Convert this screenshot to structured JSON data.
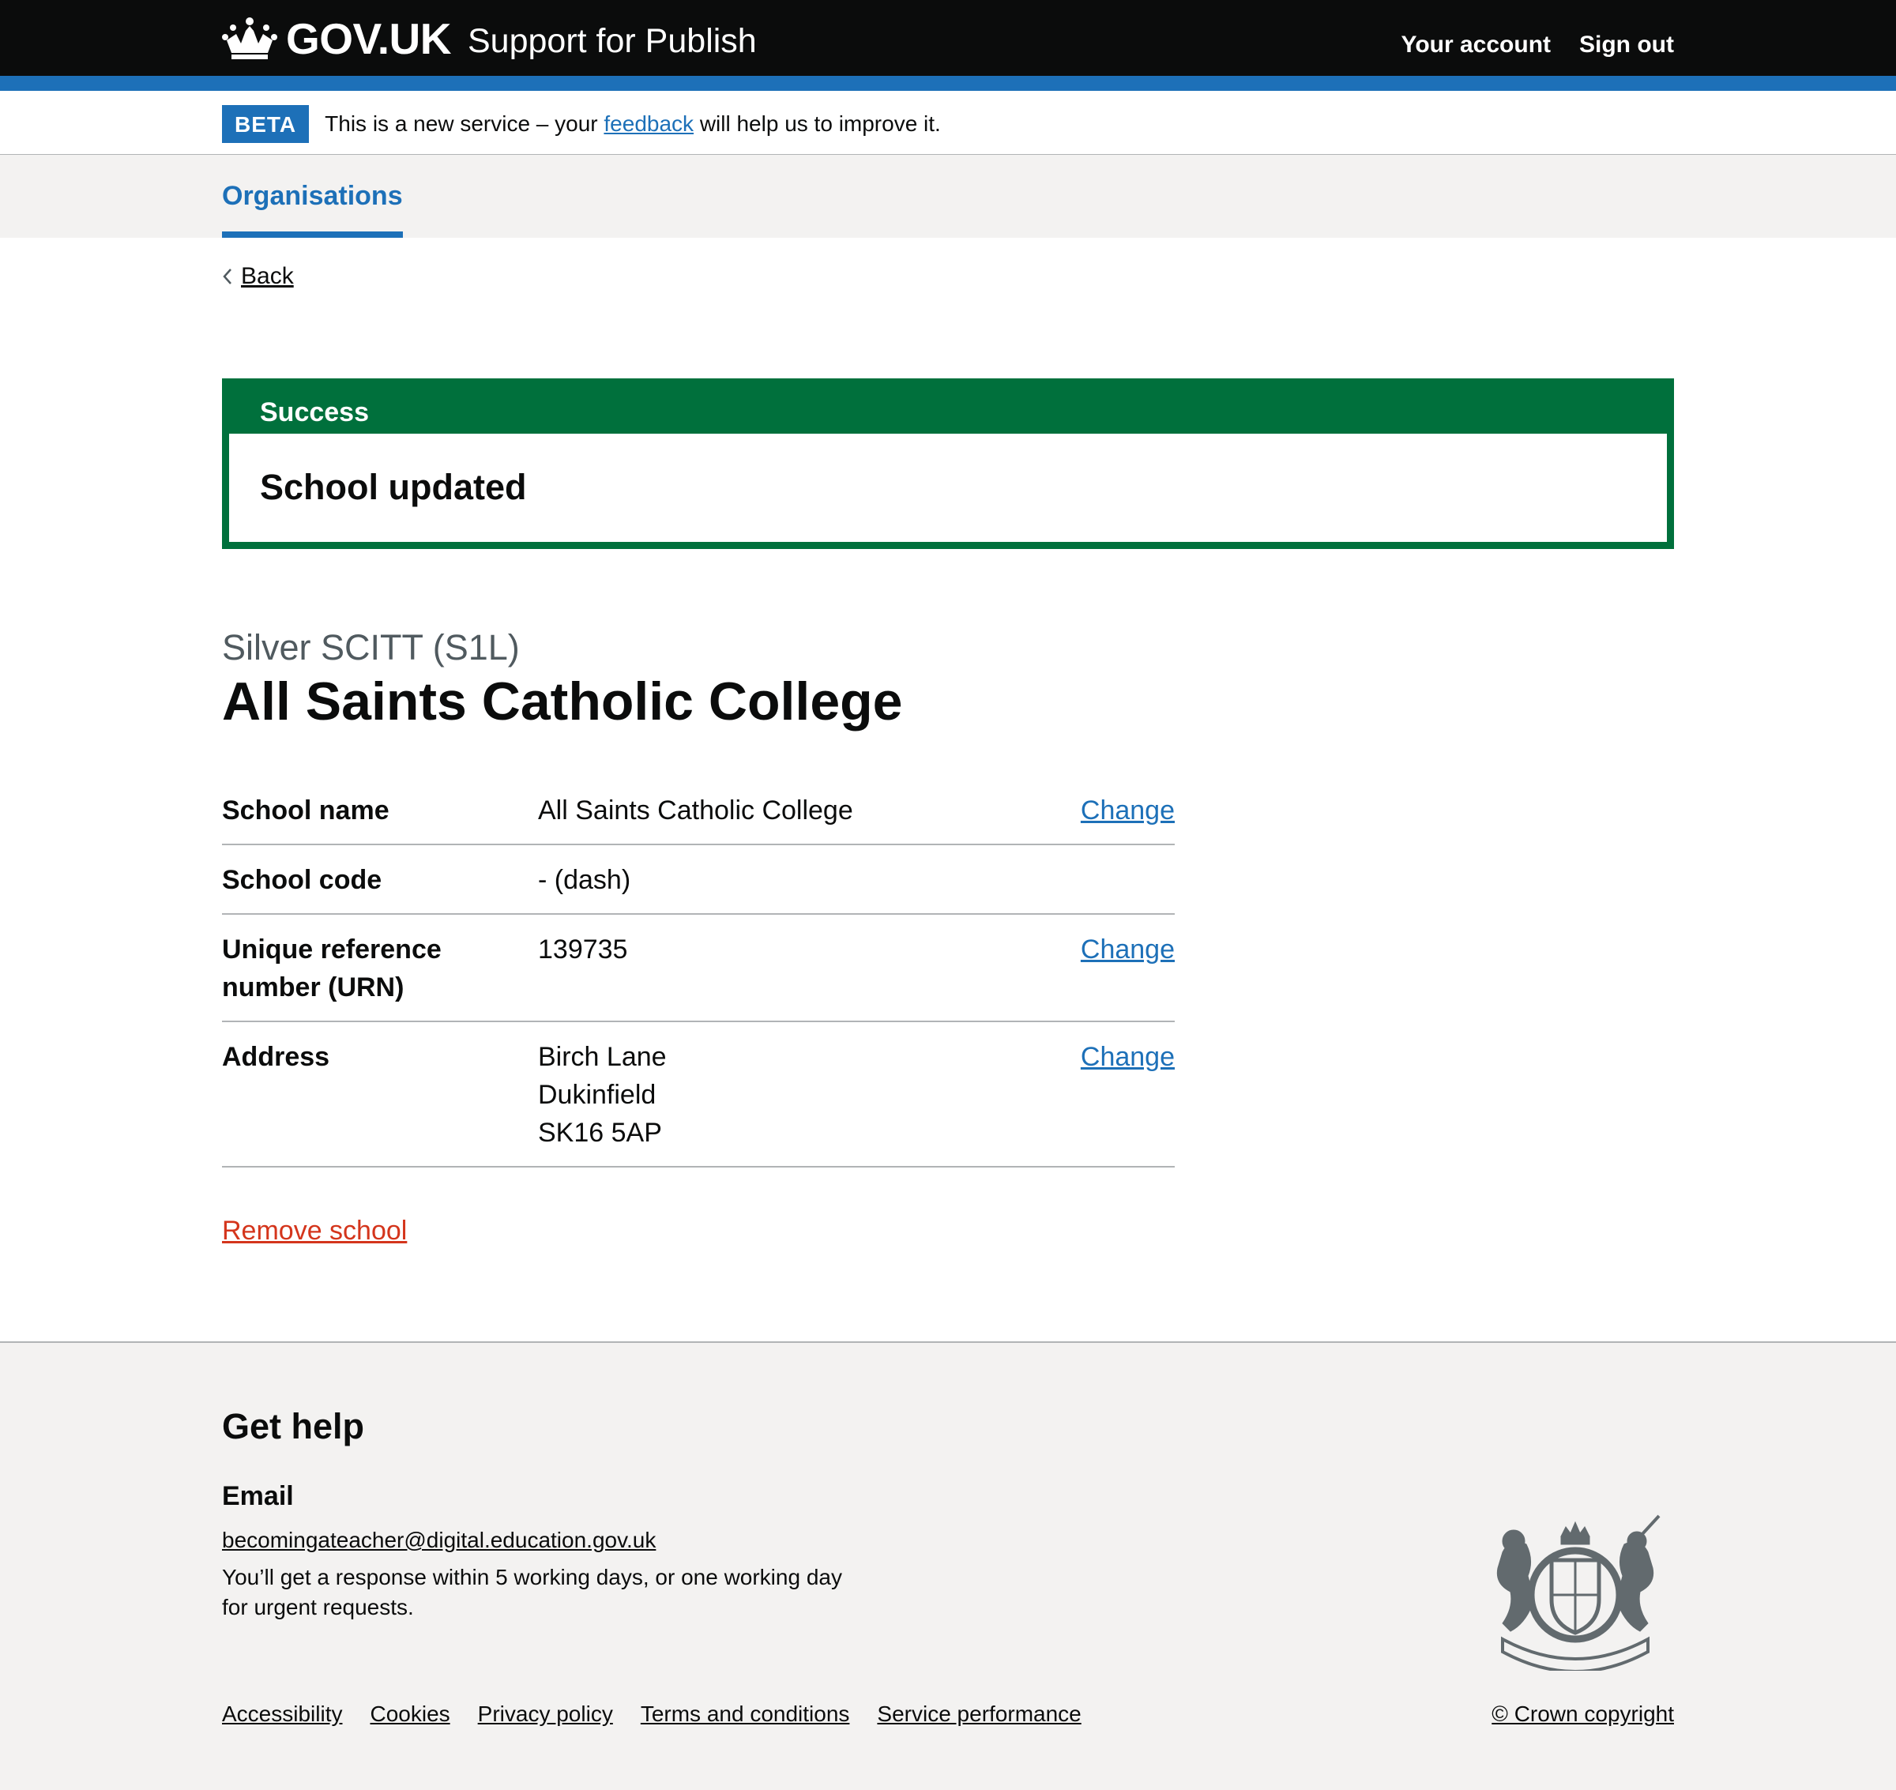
{
  "header": {
    "logo_text": "GOV.UK",
    "service_name": "Support for Publish",
    "nav": [
      "Your account",
      "Sign out"
    ]
  },
  "phase_banner": {
    "tag": "BETA",
    "text_before": "This is a new service – your ",
    "link": "feedback",
    "text_after": " will help us to improve it."
  },
  "subnav": {
    "item": "Organisations"
  },
  "back_link": "Back",
  "success_banner": {
    "title": "Success",
    "heading": "School updated"
  },
  "page": {
    "caption": "Silver SCITT (S1L)",
    "title": "All Saints Catholic College"
  },
  "summary": [
    {
      "key": "School name",
      "value": "All Saints Catholic College",
      "action": "Change"
    },
    {
      "key": "School code",
      "value": "- (dash)",
      "action": ""
    },
    {
      "key": "Unique reference number (URN)",
      "value": "139735",
      "action": "Change"
    },
    {
      "key": "Address",
      "value_lines": [
        "Birch Lane",
        "Dukinfield",
        "SK16 5AP"
      ],
      "action": "Change"
    }
  ],
  "remove_link": "Remove school",
  "footer": {
    "heading": "Get help",
    "email_label": "Email",
    "email": "becomingateacher@digital.education.gov.uk",
    "note": "You’ll get a response within 5 working days, or one working day for urgent requests.",
    "links": [
      "Accessibility",
      "Cookies",
      "Privacy policy",
      "Terms and conditions",
      "Service performance"
    ],
    "copyright": "© Crown copyright"
  },
  "colors": {
    "header_bg": "#0b0c0c",
    "brand_blue": "#1d70b8",
    "success_green": "#00703c",
    "danger_red": "#d4351c",
    "footer_bg": "#f3f2f1"
  },
  "icons": [
    "crown-icon",
    "chevron-left-icon",
    "royal-coat-of-arms-icon"
  ]
}
